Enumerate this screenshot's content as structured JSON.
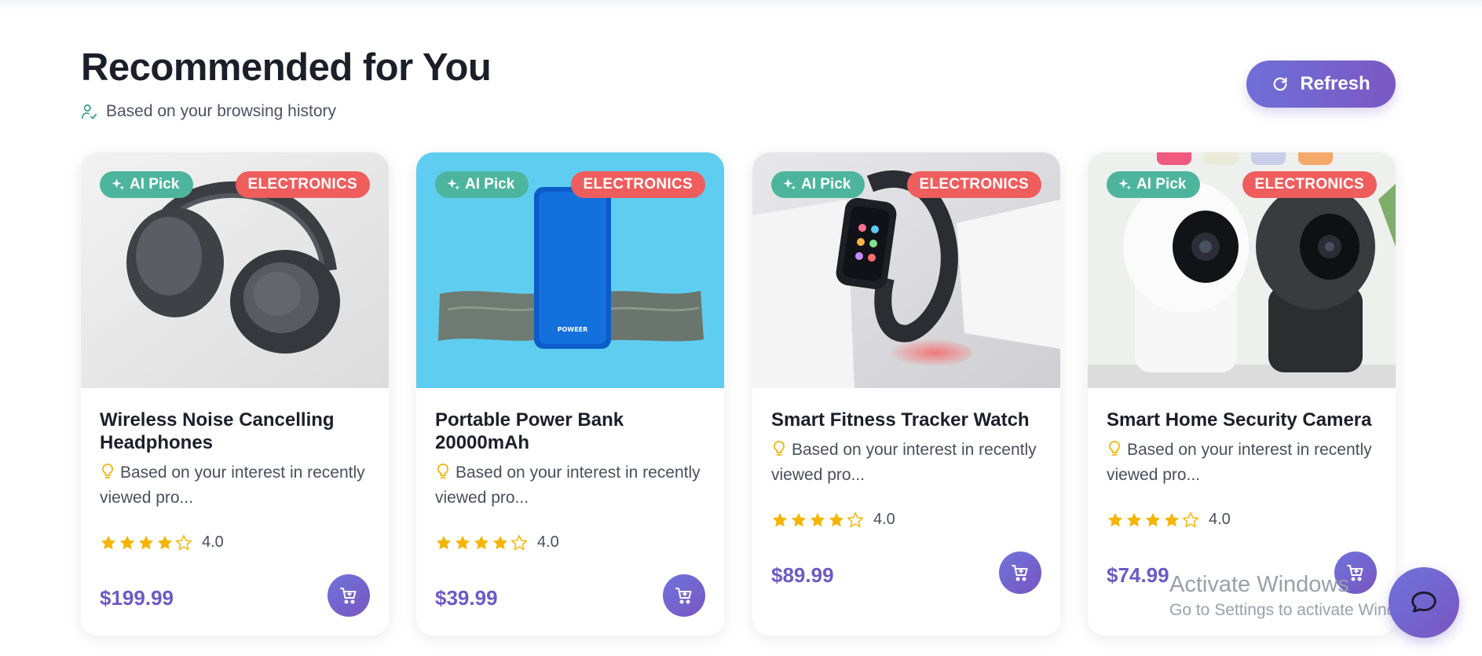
{
  "header": {
    "title": "Recommended for You",
    "subtitle": "Based on your browsing history",
    "refresh_label": "Refresh"
  },
  "products": [
    {
      "ai_badge": "AI Pick",
      "category": "ELECTRONICS",
      "title": "Wireless Noise Cancelling Headphones",
      "reason": "Based on your interest in recently viewed pro...",
      "rating": "4.0",
      "price": "$199.99"
    },
    {
      "ai_badge": "AI Pick",
      "category": "ELECTRONICS",
      "title": "Portable Power Bank 20000mAh",
      "reason": "Based on your interest in recently viewed pro...",
      "rating": "4.0",
      "price": "$39.99",
      "device_label": "POWEER"
    },
    {
      "ai_badge": "AI Pick",
      "category": "ELECTRONICS",
      "title": "Smart Fitness Tracker Watch",
      "reason": "Based on your interest in recently viewed pro...",
      "rating": "4.0",
      "price": "$89.99"
    },
    {
      "ai_badge": "AI Pick",
      "category": "ELECTRONICS",
      "title": "Smart Home Security Camera",
      "reason": "Based on your interest in recently viewed pro...",
      "rating": "4.0",
      "price": "$74.99"
    }
  ],
  "watermark": {
    "line1": "Activate Windows",
    "line2": "Go to Settings to activate Windows."
  },
  "colors": {
    "accent": "#6b5bc4",
    "ai_badge": "#4db59e",
    "category_badge": "#ef5d5d",
    "star": "#f5b400"
  },
  "icons": {
    "subtitle": "user-check-icon",
    "refresh": "refresh-icon",
    "ai_badge": "sparkle-icon",
    "reason": "lightbulb-icon",
    "star": "star-icon",
    "cart": "cart-plus-icon",
    "chat": "chat-bubble-icon"
  }
}
